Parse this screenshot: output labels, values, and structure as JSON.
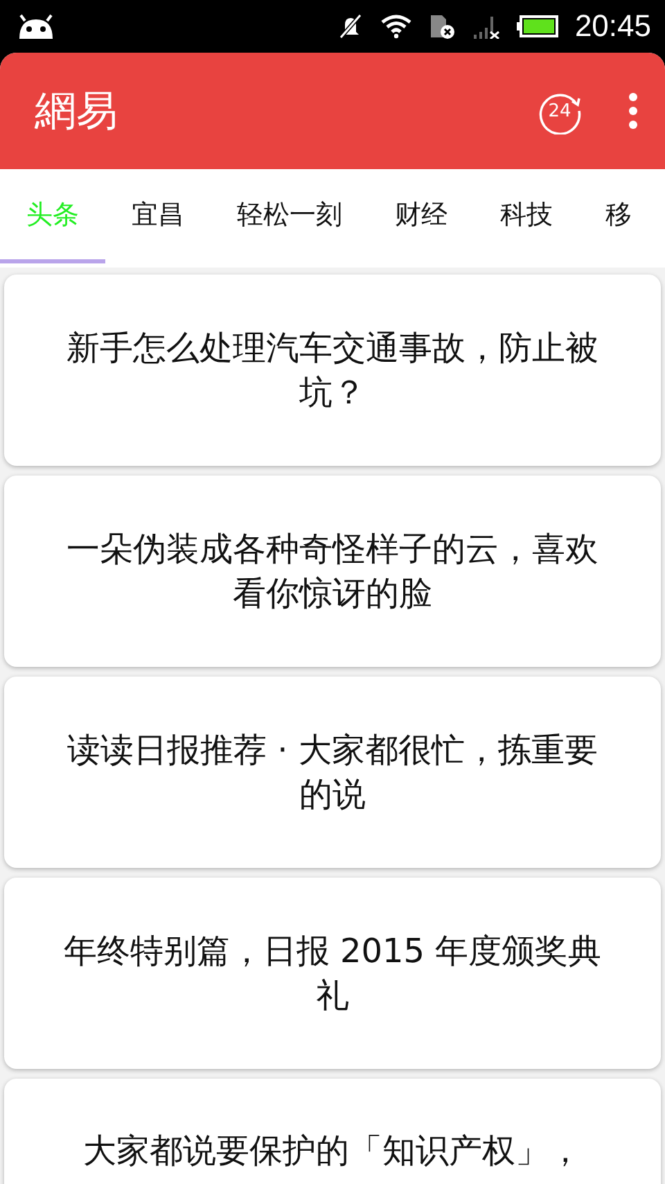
{
  "status_bar": {
    "time": "20:45"
  },
  "app_bar": {
    "title": "網易",
    "history_badge": "24"
  },
  "tabs": [
    {
      "label": "头条",
      "selected": true
    },
    {
      "label": "宜昌",
      "selected": false
    },
    {
      "label": "轻松一刻",
      "selected": false
    },
    {
      "label": "财经",
      "selected": false
    },
    {
      "label": "科技",
      "selected": false
    },
    {
      "label": "移",
      "selected": false
    }
  ],
  "articles": [
    {
      "title": "新手怎么处理汽车交通事故，防止被坑？"
    },
    {
      "title": "一朵伪装成各种奇怪样子的云，喜欢看你惊讶的脸"
    },
    {
      "title": "读读日报推荐 · 大家都很忙，拣重要的说"
    },
    {
      "title": "年终特别篇，日报 2015 年度颁奖典礼"
    },
    {
      "title": "大家都说要保护的「知识产权」，"
    }
  ]
}
